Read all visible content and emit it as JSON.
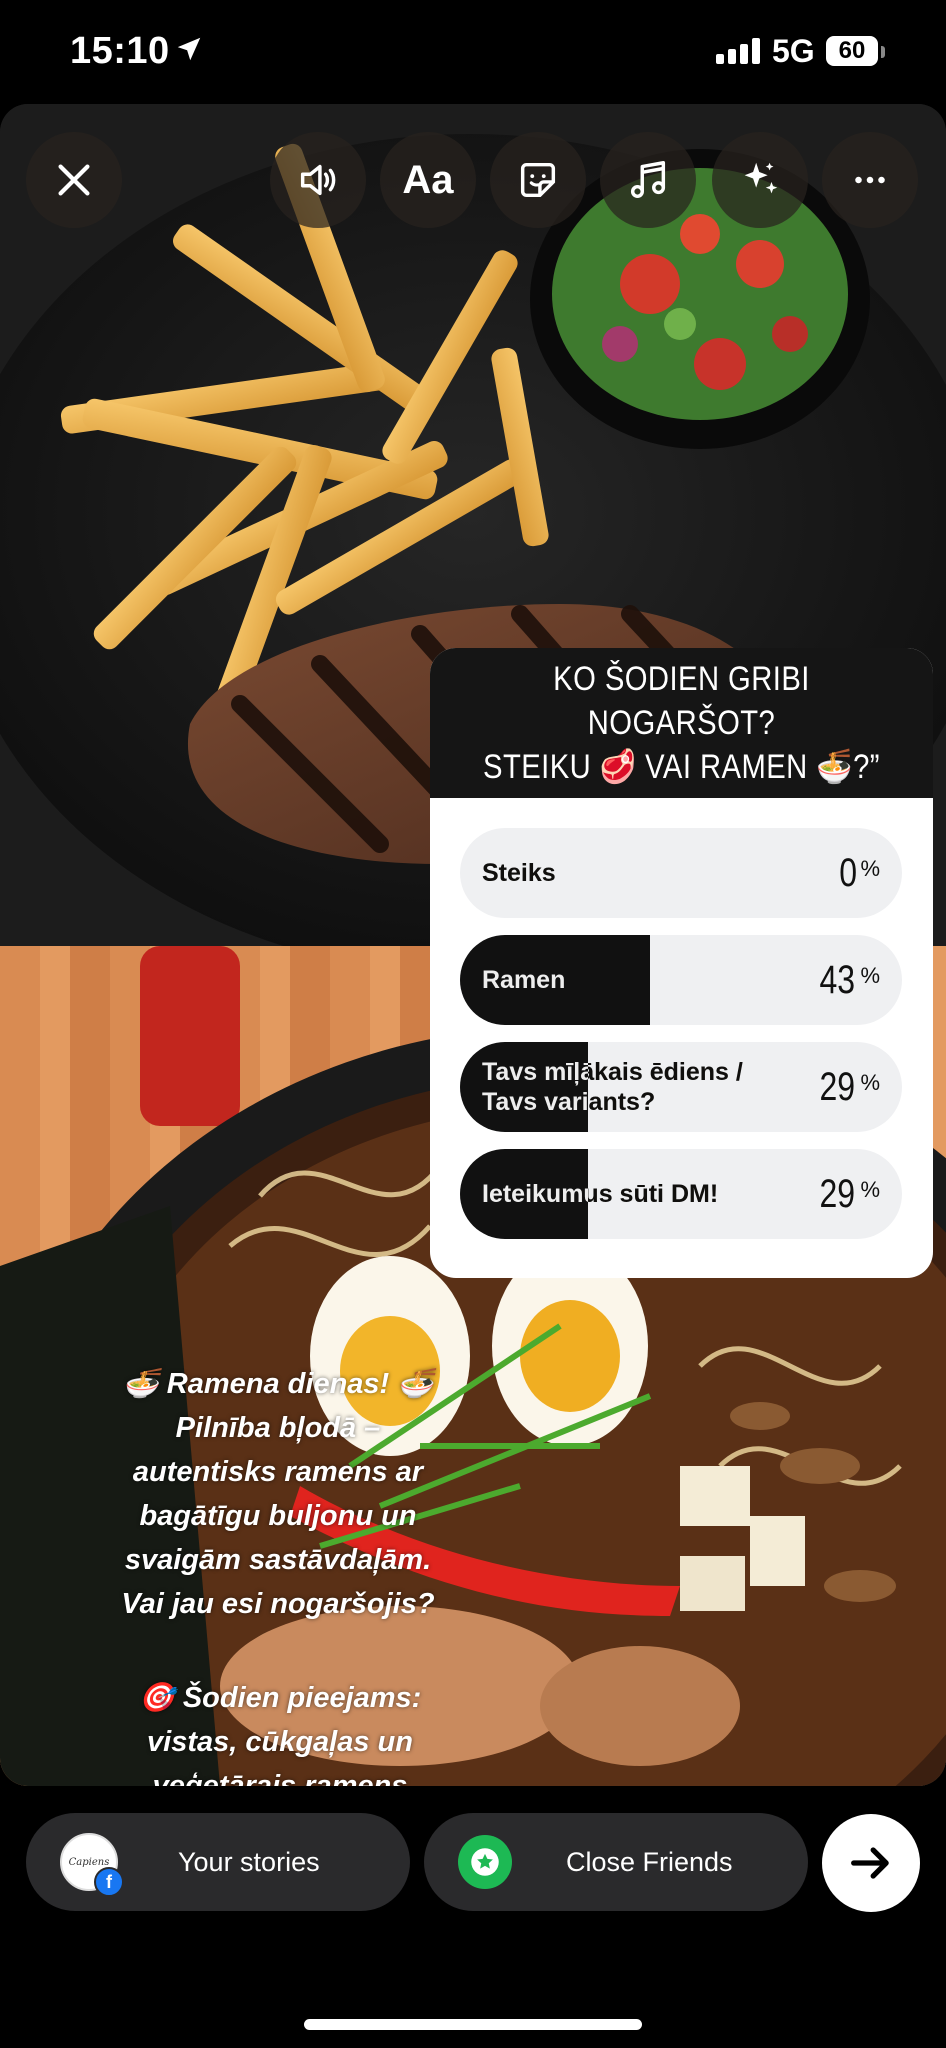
{
  "status_bar": {
    "time": "15:10",
    "network": "5G",
    "battery": "60"
  },
  "toolbar": {
    "close": "close-icon",
    "sound": "speaker-icon",
    "text": "Aa",
    "sticker": "sticker-icon",
    "music": "music-note-icon",
    "effects": "sparkles-icon",
    "more": "more-icon"
  },
  "poll": {
    "question": "KO ŠODIEN GRIBI NOGARŠOT?\nSTEIKU 🥩 VAI RAMEN 🍜?”",
    "options": [
      {
        "label": "Steiks",
        "percent": "0",
        "value": 0
      },
      {
        "label": "Ramen",
        "percent": "43",
        "value": 43
      },
      {
        "label": "Tavs mīļākais ēdiens / Tavs variants?",
        "percent": "29",
        "value": 29
      },
      {
        "label": "Ieteikumus sūti DM!",
        "percent": "29",
        "value": 29
      }
    ],
    "percent_sign": "%"
  },
  "caption": {
    "line1": "🍜 Ramena dienas! 🍜\nPilnība bļodā –\nautentisks ramens ar\nbagātīgu buljonu un\nsvaigām sastāvdaļām.\nVai jau esi nogaršojis?",
    "line2": "🎯 Šodien pieejams:\nvistas, cūkgaļas un\nveģetārais ramens"
  },
  "bottom": {
    "your_stories": "Your stories",
    "close_friends": "Close Friends",
    "avatar_text": "Capiens"
  },
  "colors": {
    "close_friends_green": "#1DB954",
    "poll_bar": "#111111",
    "poll_track": "#EFF0F2"
  }
}
